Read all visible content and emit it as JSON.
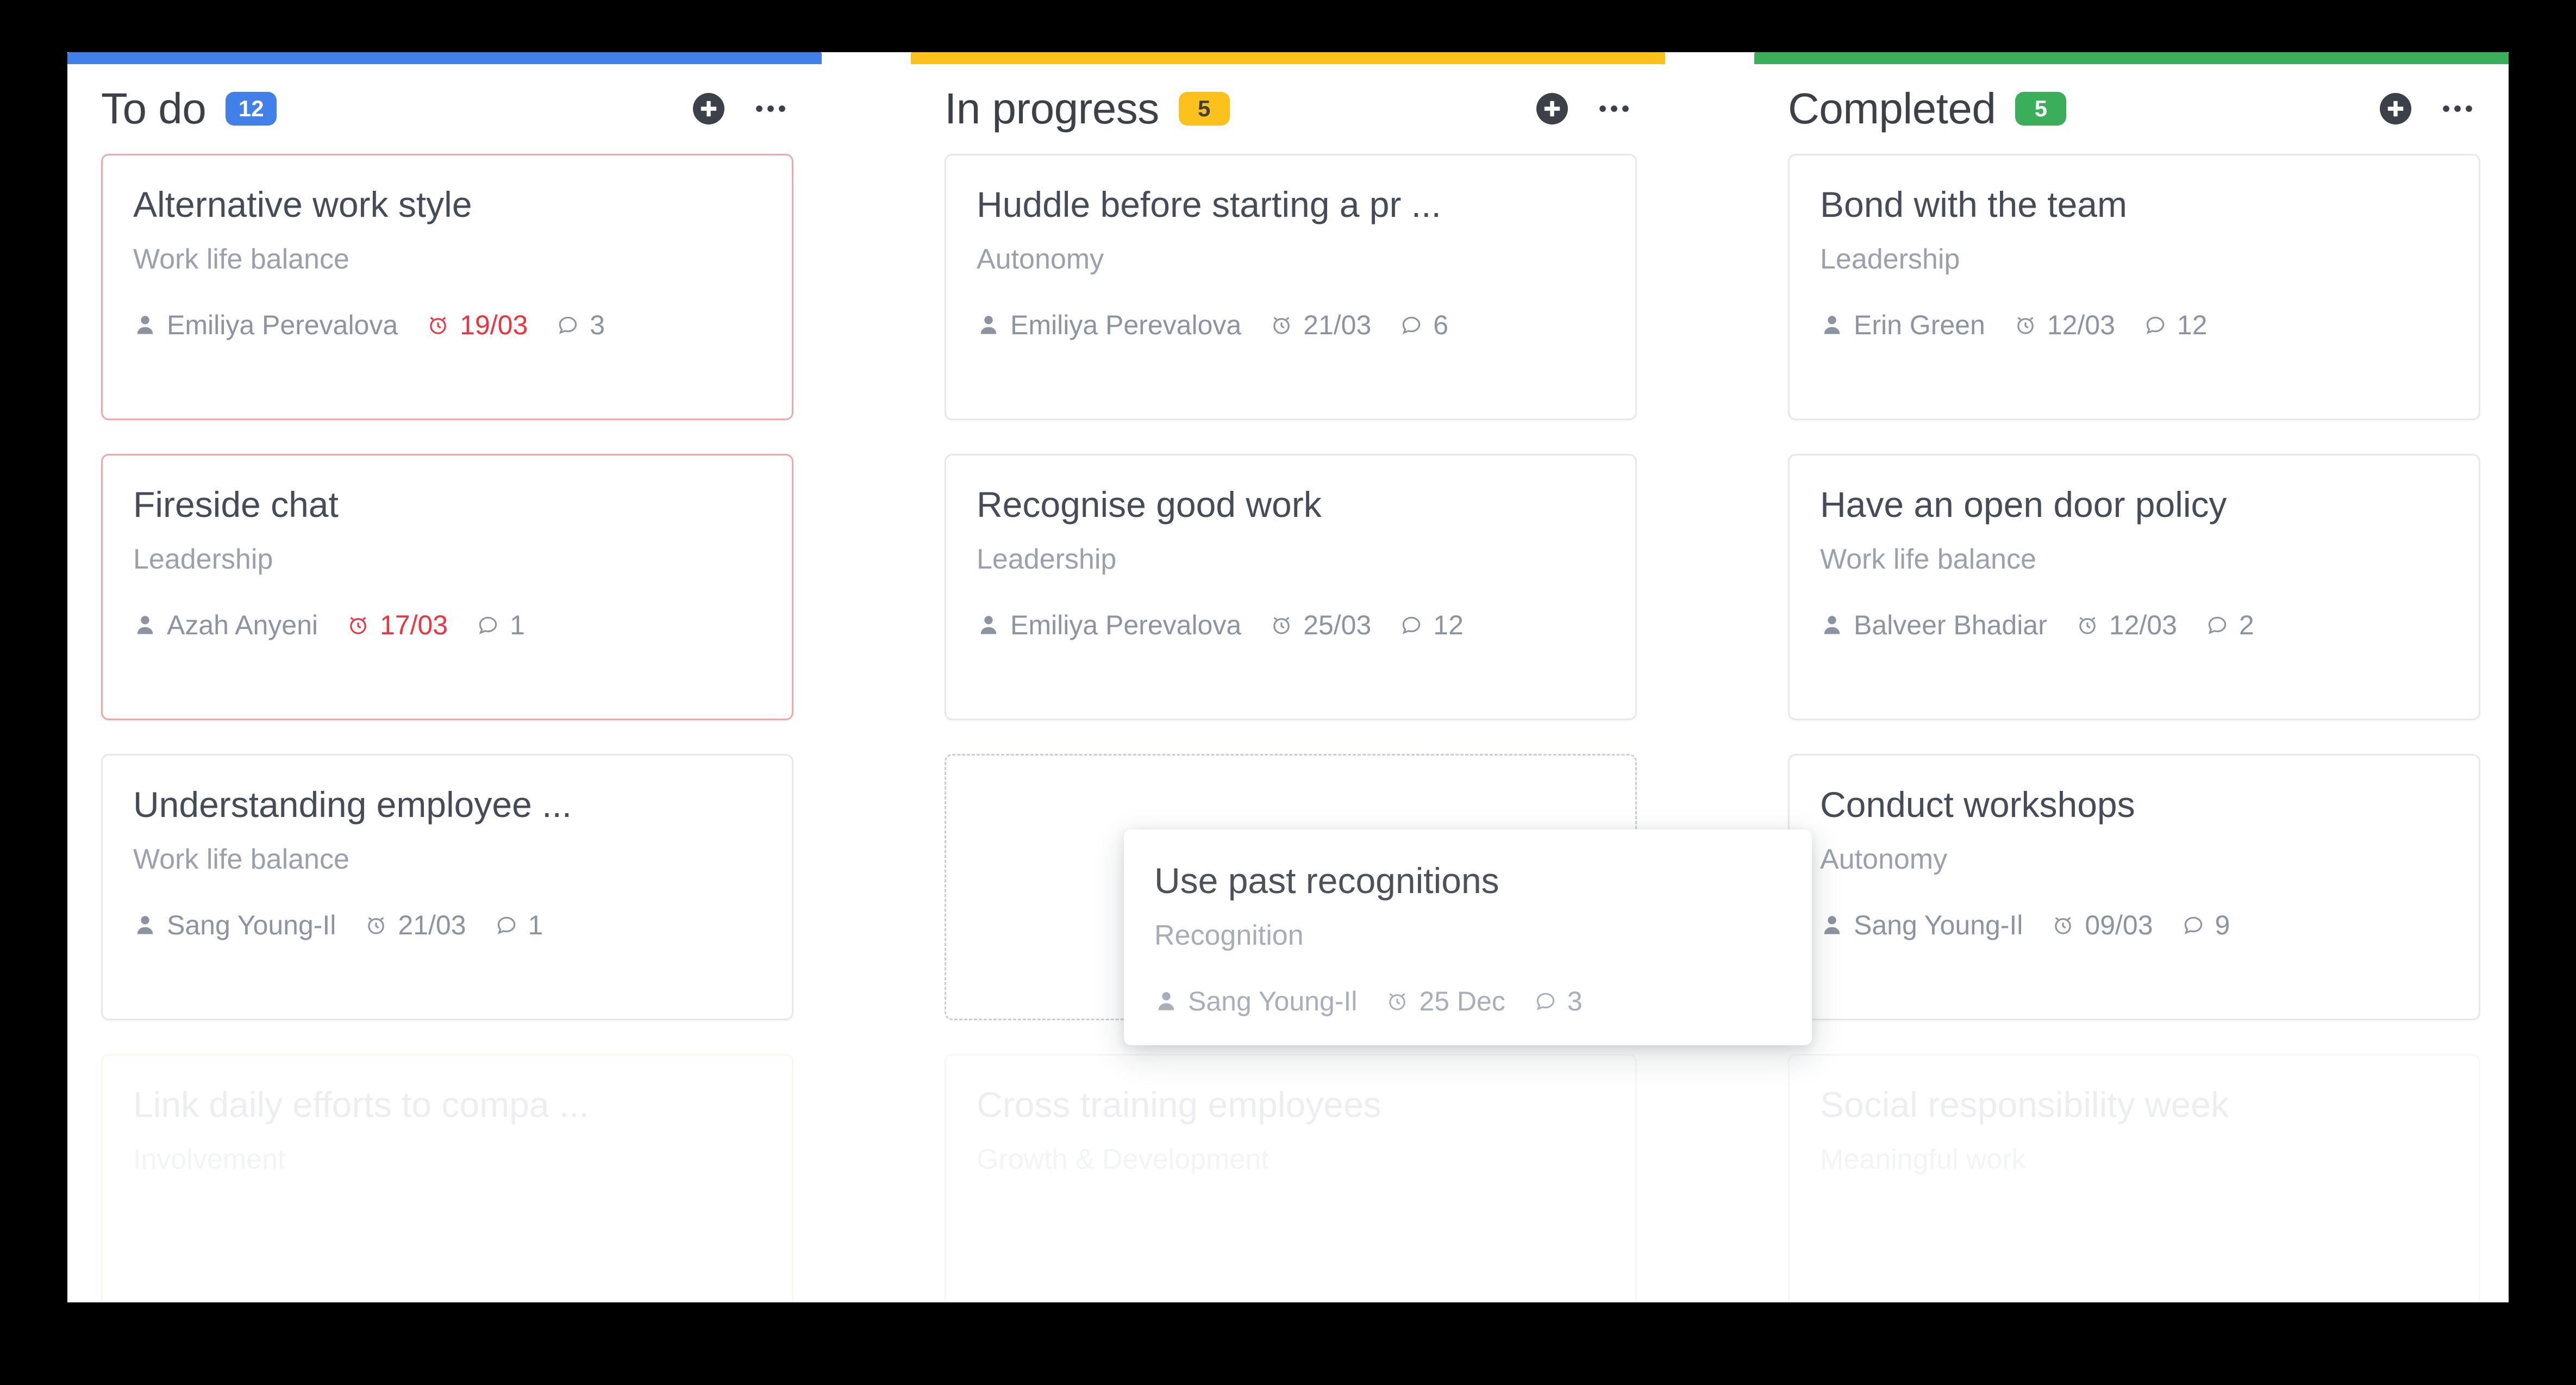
{
  "board": {
    "columns": [
      {
        "id": "todo",
        "title": "To do",
        "count": "12",
        "accent_color": "#4180e8",
        "badge_color": "#4180e8",
        "add_icon": "plus-circle-icon",
        "menu_icon": "more-horizontal-icon",
        "cards": [
          {
            "title": "Alternative work style",
            "category": "Work life balance",
            "assignee": "Emiliya Perevalova",
            "due": "19/03",
            "overdue": true,
            "comments": "3"
          },
          {
            "title": "Fireside chat",
            "category": "Leadership",
            "assignee": "Azah Anyeni",
            "due": "17/03",
            "overdue": true,
            "comments": "1"
          },
          {
            "title": "Understanding employee ...",
            "category": "Work life balance",
            "assignee": "Sang Young-Il",
            "due": "21/03",
            "overdue": false,
            "comments": "1"
          },
          {
            "title": "Link daily efforts to compa ...",
            "category": "Involvement",
            "assignee": "",
            "due": "",
            "overdue": false,
            "comments": "",
            "faded": true
          }
        ]
      },
      {
        "id": "inprogress",
        "title": "In progress",
        "count": "5",
        "accent_color": "#fcc21b",
        "badge_color": "#fcc21b",
        "badge_text_color": "#3c4149",
        "add_icon": "plus-circle-icon",
        "menu_icon": "more-horizontal-icon",
        "cards": [
          {
            "title": "Huddle before starting a pr ...",
            "category": "Autonomy",
            "assignee": "Emiliya Perevalova",
            "due": "21/03",
            "overdue": false,
            "comments": "6"
          },
          {
            "title": "Recognise good work",
            "category": "Leadership",
            "assignee": "Emiliya Perevalova",
            "due": "25/03",
            "overdue": false,
            "comments": "12"
          },
          {
            "title": "Cross training employees",
            "category": "Growth & Development",
            "assignee": "",
            "due": "",
            "overdue": false,
            "comments": "",
            "faded": true
          }
        ]
      },
      {
        "id": "completed",
        "title": "Completed",
        "count": "5",
        "accent_color": "#3aae5a",
        "badge_color": "#3aae5a",
        "add_icon": "plus-circle-icon",
        "menu_icon": "more-horizontal-icon",
        "cards": [
          {
            "title": "Bond with the team",
            "category": "Leadership",
            "assignee": "Erin Green",
            "due": "12/03",
            "overdue": false,
            "comments": "12"
          },
          {
            "title": "Have an open door policy",
            "category": "Work life balance",
            "assignee": "Balveer Bhadiar",
            "due": "12/03",
            "overdue": false,
            "comments": "2"
          },
          {
            "title": "Conduct workshops",
            "category": "Autonomy",
            "assignee": "Sang Young-Il",
            "due": "09/03",
            "overdue": false,
            "comments": "9"
          },
          {
            "title": "Social responsibility week",
            "category": "Meaningful work",
            "assignee": "",
            "due": "",
            "overdue": false,
            "comments": "",
            "faded": true
          }
        ]
      }
    ]
  },
  "drag_card": {
    "title": "Use past recognitions",
    "category": "Recognition",
    "assignee": "Sang Young-Il",
    "due": "25 Dec",
    "comments": "3"
  },
  "icons": {
    "assignee": "person-icon",
    "due": "alarm-clock-icon",
    "comments": "comment-bubble-icon"
  }
}
